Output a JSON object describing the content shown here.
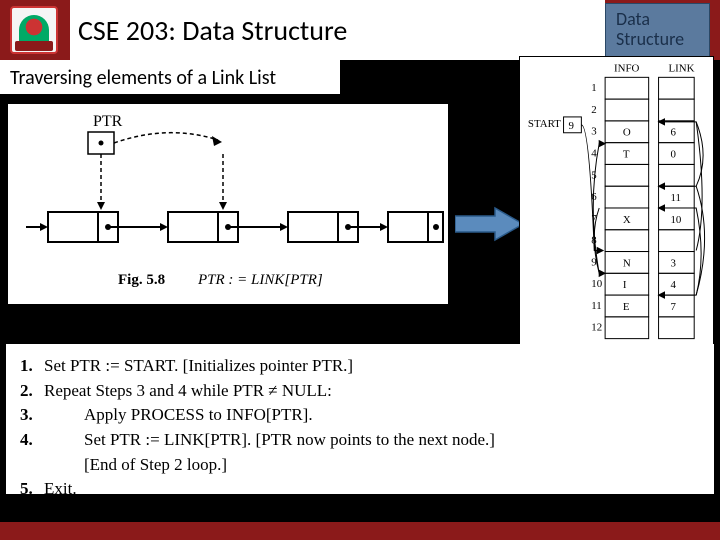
{
  "header": {
    "course_title": "CSE 203: Data Structure",
    "badge_line1": "Data",
    "badge_line2": "Structure"
  },
  "subtitle": "Traversing elements of a Link List",
  "left_diagram": {
    "ptr_label": "PTR",
    "caption_prefix": "Fig. 5.8",
    "caption_expr": "PTR : = LINK[PTR]"
  },
  "right_table": {
    "col1": "INFO",
    "col2": "LINK",
    "start_label": "START",
    "start_value": "9",
    "rows": [
      {
        "idx": "1",
        "info": "",
        "link": ""
      },
      {
        "idx": "2",
        "info": "",
        "link": ""
      },
      {
        "idx": "3",
        "info": "O",
        "link": "6"
      },
      {
        "idx": "4",
        "info": "T",
        "link": "0"
      },
      {
        "idx": "5",
        "info": "",
        "link": ""
      },
      {
        "idx": "6",
        "info": "",
        "link": "11"
      },
      {
        "idx": "7",
        "info": "X",
        "link": "10"
      },
      {
        "idx": "8",
        "info": "",
        "link": ""
      },
      {
        "idx": "9",
        "info": "N",
        "link": "3"
      },
      {
        "idx": "10",
        "info": "I",
        "link": "4"
      },
      {
        "idx": "11",
        "info": "E",
        "link": "7"
      },
      {
        "idx": "12",
        "info": "",
        "link": ""
      }
    ]
  },
  "algorithm": {
    "lines": [
      {
        "num": "1.",
        "text": "Set PTR := START. [Initializes pointer PTR.]"
      },
      {
        "num": "2.",
        "text": "Repeat Steps 3 and 4 while PTR ≠ NULL:"
      },
      {
        "num": "3.",
        "text": "Apply PROCESS to INFO[PTR]."
      },
      {
        "num": "4.",
        "text": "Set PTR := LINK[PTR]. [PTR now points to the next node.]"
      },
      {
        "num": "",
        "text": "[End of Step 2 loop.]"
      },
      {
        "num": "5.",
        "text": "Exit."
      }
    ]
  }
}
